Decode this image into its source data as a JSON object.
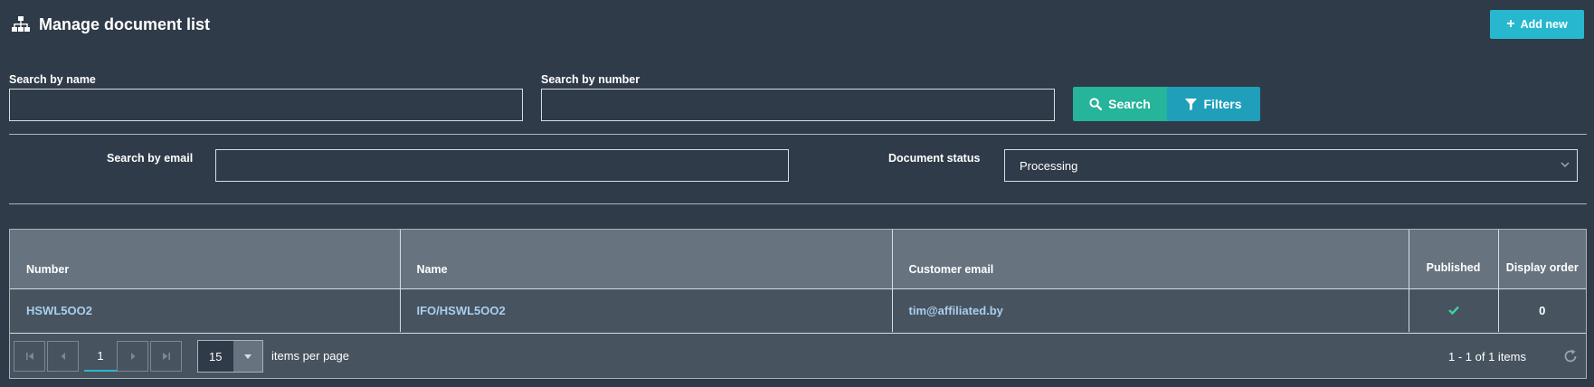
{
  "header": {
    "title": "Manage document list",
    "add_new_label": "Add new"
  },
  "search": {
    "name_label": "Search by name",
    "name_value": "",
    "number_label": "Search by number",
    "number_value": "",
    "search_button_label": "Search",
    "filters_button_label": "Filters",
    "email_label": "Search by email",
    "email_value": "",
    "status_label": "Document status",
    "status_value": "Processing"
  },
  "table": {
    "columns": [
      "Number",
      "Name",
      "Customer email",
      "Published",
      "Display order"
    ],
    "rows": [
      {
        "number": "HSWL5OO2",
        "name": "IFO/HSWL5OO2",
        "email": "tim@affiliated.by",
        "published": true,
        "display_order": "0"
      }
    ]
  },
  "pager": {
    "current_page": "1",
    "page_size": "15",
    "items_per_page_label": "items per page",
    "info": "1 - 1 of 1 items"
  },
  "colors": {
    "background": "#2f3b48",
    "accent": "#27b8cf",
    "search_green": "#26b49a",
    "link": "#a9cfee",
    "check": "#3fcf9f"
  },
  "icons": {
    "title": "sitemap-icon",
    "add": "plus-icon",
    "search": "search-icon",
    "filters": "filter-icon",
    "status_dropdown": "chevron-down-icon",
    "published": "check-icon",
    "refresh": "refresh-icon"
  }
}
